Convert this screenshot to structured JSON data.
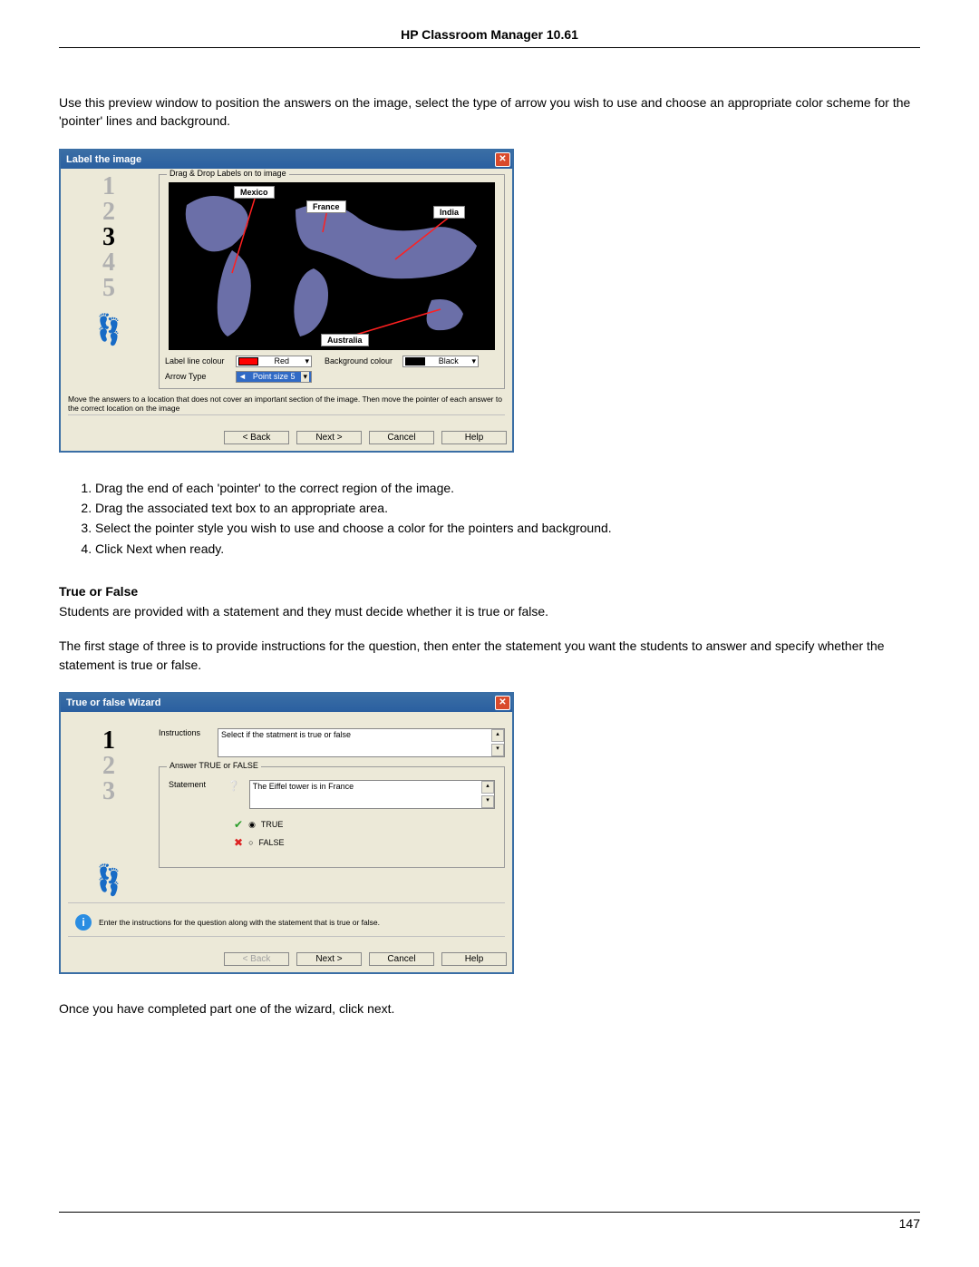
{
  "header": {
    "title": "HP Classroom Manager 10.61"
  },
  "intro": "Use this preview window to position the answers on the image, select the type of arrow you wish to use and choose an appropriate color scheme for the 'pointer' lines and background.",
  "dialog1": {
    "title": "Label the image",
    "group_title": "Drag & Drop Labels on to image",
    "labels": {
      "mexico": "Mexico",
      "france": "France",
      "india": "India",
      "australia": "Australia"
    },
    "steps_active": "3",
    "opt_label_line": "Label line colour",
    "opt_line_value": "Red",
    "opt_bg": "Background colour",
    "opt_bg_value": "Black",
    "opt_arrow": "Arrow Type",
    "opt_arrow_value": "Point size 5",
    "hint": "Move the answers to a location that does not cover an important section of the image. Then move the pointer of each answer to the correct location on the image",
    "buttons": {
      "back": "< Back",
      "next": "Next >",
      "cancel": "Cancel",
      "help": "Help"
    }
  },
  "steps": [
    "Drag the end of each 'pointer' to the correct region of the image.",
    "Drag the associated text box to an appropriate area.",
    "Select the pointer style you wish to use and choose a color for the pointers and background.",
    "Click Next when ready."
  ],
  "tf_heading": "True or False",
  "tf_desc": "Students are provided with a statement and they must decide whether it is true or false.",
  "tf_desc2": "The first stage of three is to provide instructions for the question, then enter the statement you want the students to answer and specify whether the statement is true or false.",
  "dialog2": {
    "title": "True or false Wizard",
    "instructions_label": "Instructions",
    "instructions_value": "Select if the statment is true or false",
    "group_title": "Answer TRUE or FALSE",
    "statement_label": "Statement",
    "statement_value": "The Eiffel tower is in France",
    "true_label": "TRUE",
    "false_label": "FALSE",
    "info": "Enter the instructions for the question along with the statement that is true or false.",
    "buttons": {
      "back": "< Back",
      "next": "Next >",
      "cancel": "Cancel",
      "help": "Help"
    }
  },
  "after_dialog2": "Once you have completed part one of the wizard, click next.",
  "page_number": "147"
}
